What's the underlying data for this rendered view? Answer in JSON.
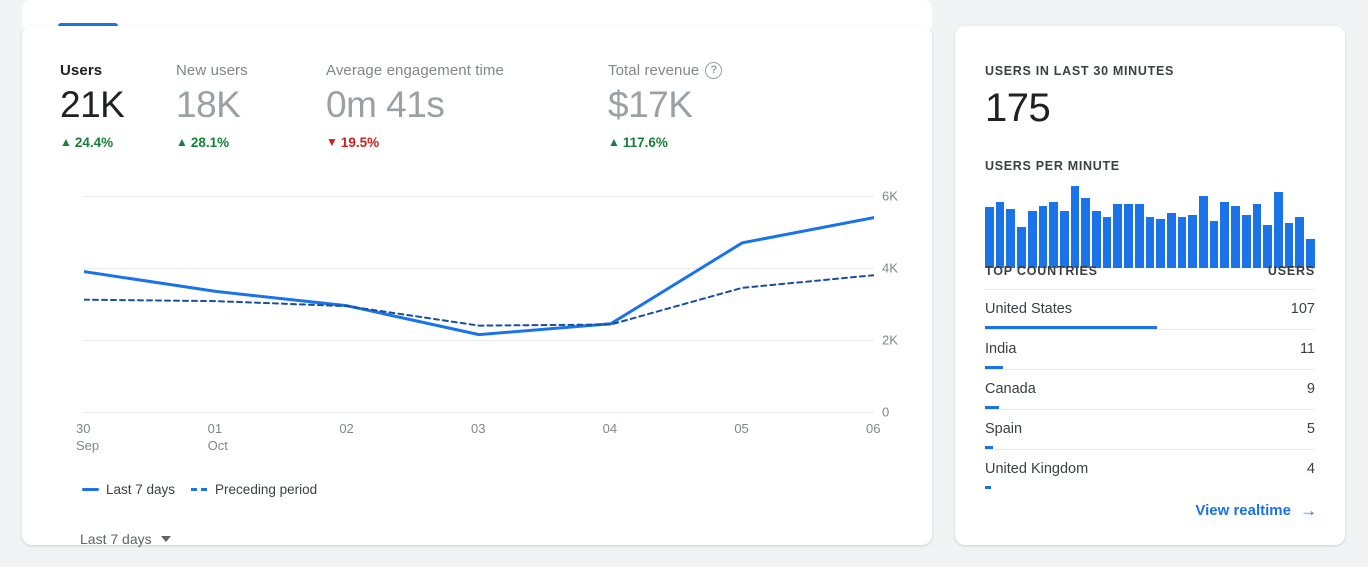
{
  "overview": {
    "tab_indicator": "active-tab",
    "metrics": [
      {
        "label": "Users",
        "value": "21K",
        "delta": "24.4%",
        "direction": "up",
        "primary": true,
        "help": false
      },
      {
        "label": "New users",
        "value": "18K",
        "delta": "28.1%",
        "direction": "up",
        "primary": false,
        "help": false
      },
      {
        "label": "Average engagement time",
        "value": "0m 41s",
        "delta": "19.5%",
        "direction": "down",
        "primary": false,
        "help": false
      },
      {
        "label": "Total revenue",
        "value": "$17K",
        "delta": "117.6%",
        "direction": "up",
        "primary": false,
        "help": true,
        "help_glyph": "?"
      }
    ],
    "legend": [
      {
        "label": "Last 7 days",
        "style": "solid"
      },
      {
        "label": "Preceding period",
        "style": "dashed"
      }
    ],
    "date_selector": {
      "label": "Last 7 days",
      "icon": "chevron-down-icon"
    }
  },
  "chart_data": {
    "type": "line",
    "title": "",
    "xlabel": "",
    "ylabel": "",
    "ylim": [
      0,
      6000
    ],
    "yticks": [
      6000,
      4000,
      2000,
      0
    ],
    "ytick_labels": [
      "6K",
      "4K",
      "2K",
      "0"
    ],
    "grid": true,
    "legend_position": "bottom-left",
    "categories": [
      "30",
      "01",
      "02",
      "03",
      "04",
      "05",
      "06"
    ],
    "category_sublabels": [
      "Sep",
      "Oct",
      "",
      "",
      "",
      "",
      ""
    ],
    "series": [
      {
        "name": "Last 7 days",
        "style": "solid",
        "color": "#1a73e8",
        "values": [
          3900,
          3350,
          2950,
          2150,
          2450,
          4700,
          5400
        ]
      },
      {
        "name": "Preceding period",
        "style": "dashed",
        "color": "#1a4fa0",
        "values": [
          3120,
          3080,
          2940,
          2400,
          2430,
          3450,
          3800
        ]
      }
    ]
  },
  "realtime": {
    "header": "USERS IN LAST 30 MINUTES",
    "active_users": "175",
    "per_minute_label": "USERS PER MINUTE",
    "per_minute_values": [
      62,
      68,
      60,
      42,
      58,
      64,
      68,
      58,
      84,
      72,
      58,
      52,
      66,
      66,
      66,
      52,
      50,
      56,
      52,
      54,
      74,
      48,
      68,
      64,
      54,
      66,
      44,
      78,
      46,
      52,
      30
    ],
    "countries_header": {
      "name": "TOP COUNTRIES",
      "users": "USERS"
    },
    "countries": [
      {
        "name": "United States",
        "users": "107",
        "bar_pct": 100
      },
      {
        "name": "India",
        "users": "11",
        "bar_pct": 10.3
      },
      {
        "name": "Canada",
        "users": "9",
        "bar_pct": 8.4
      },
      {
        "name": "Spain",
        "users": "5",
        "bar_pct": 4.7
      },
      {
        "name": "United Kingdom",
        "users": "4",
        "bar_pct": 3.7
      }
    ],
    "view_link": {
      "label": "View realtime",
      "icon": "arrow-right-icon",
      "glyph": "→"
    }
  },
  "colors": {
    "accent": "#1a73e8",
    "positive": "#188038",
    "negative": "#c5221f",
    "page_bg": "#f1f3f4"
  }
}
